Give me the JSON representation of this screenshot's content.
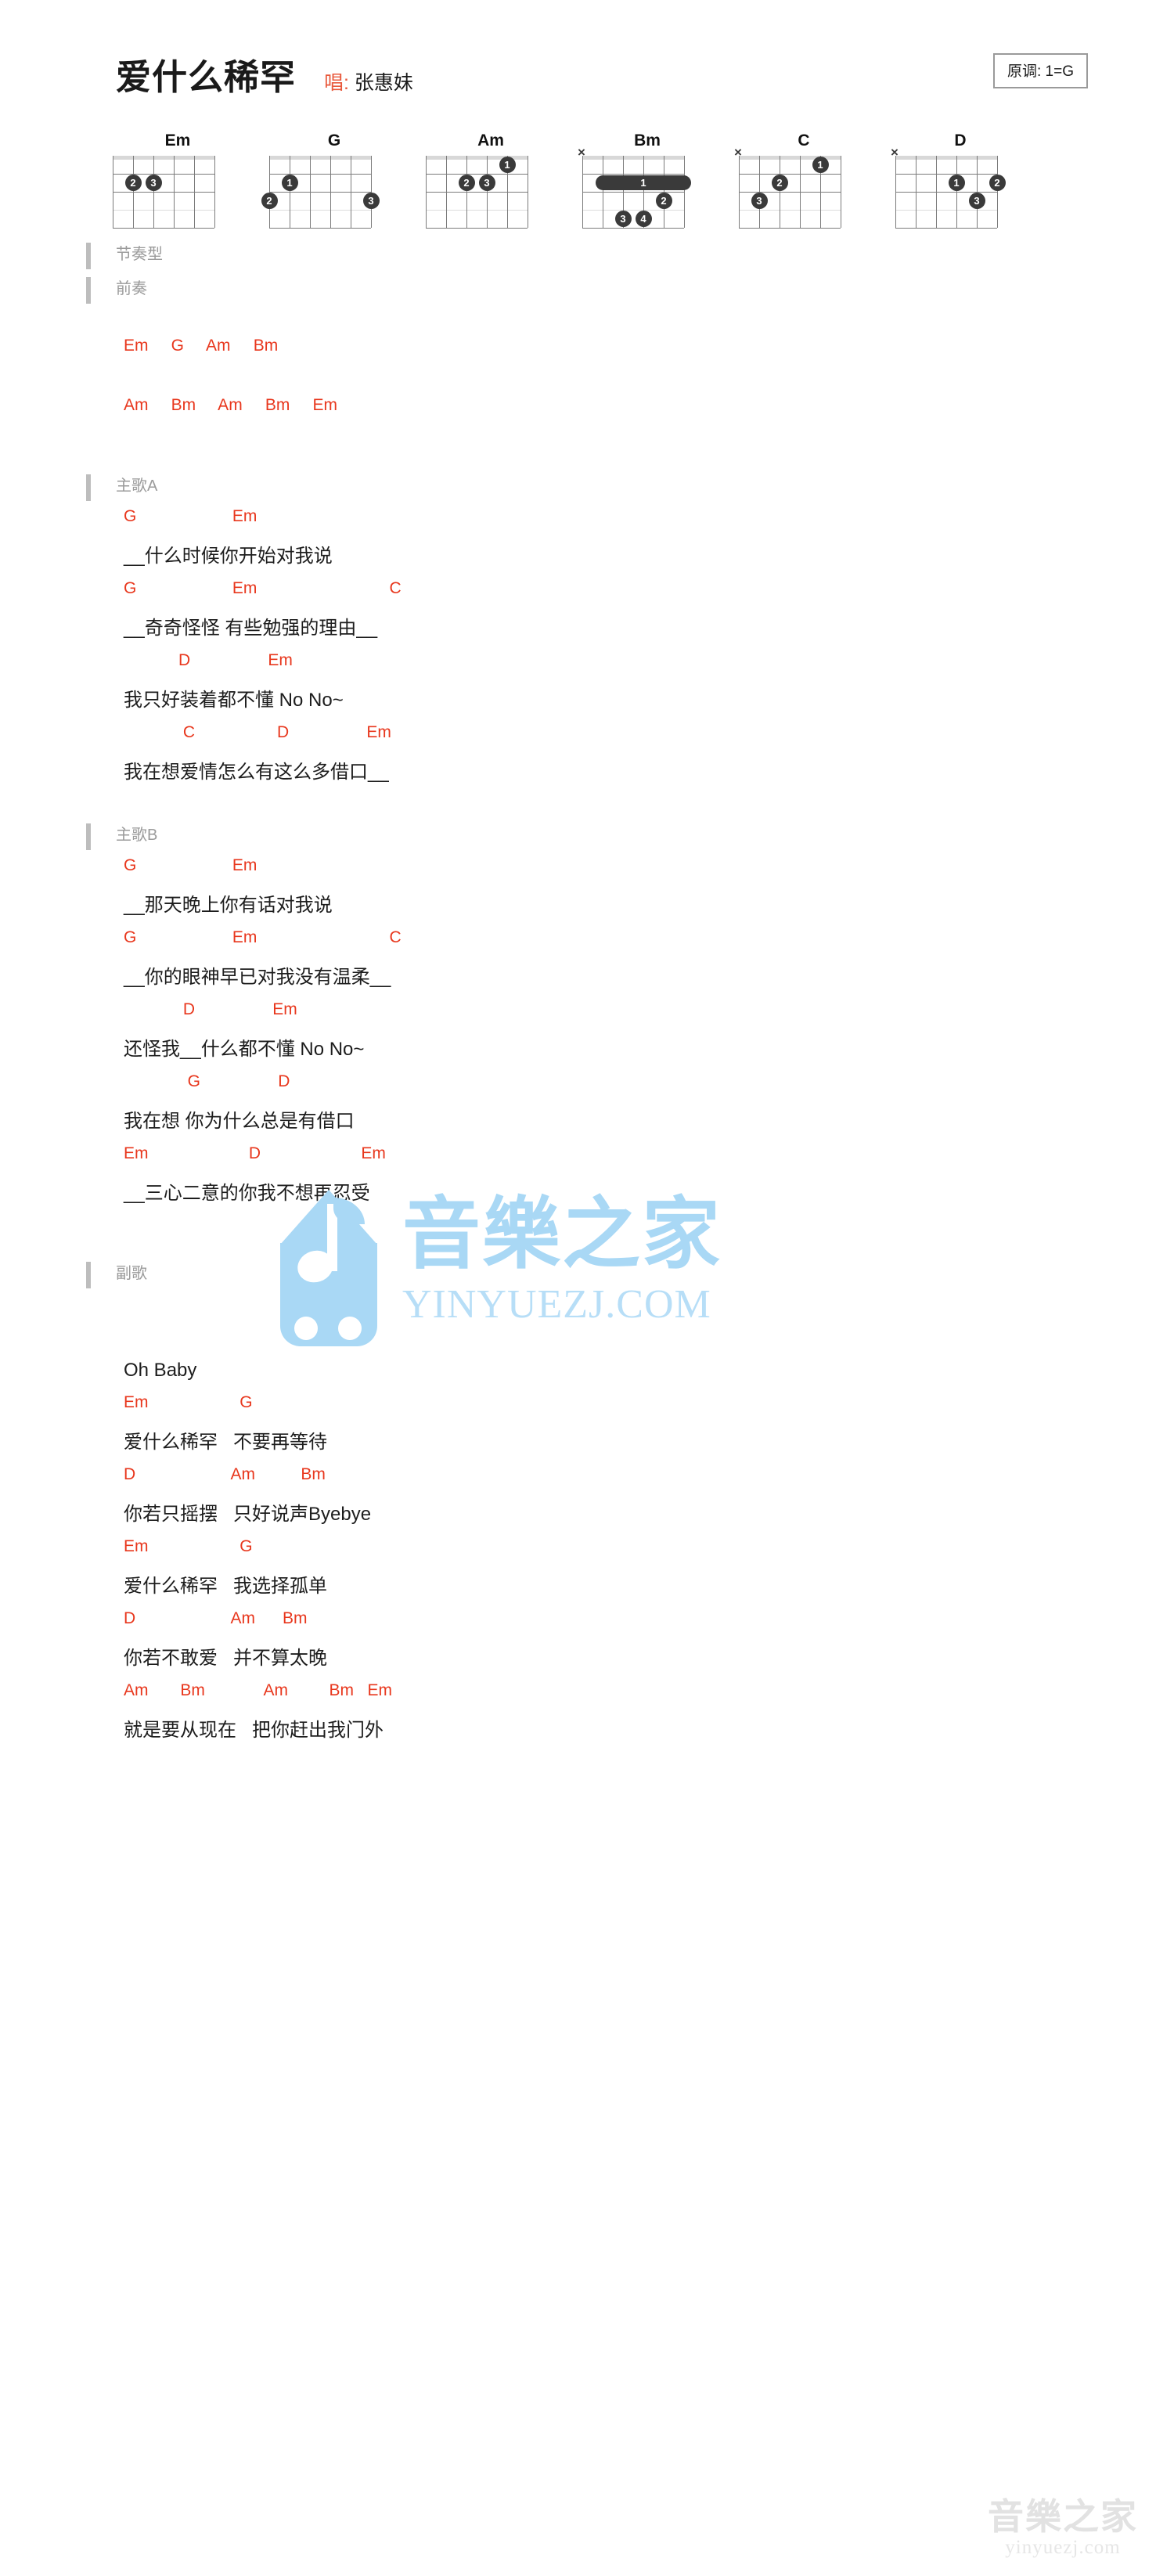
{
  "header": {
    "song_title": "爱什么稀罕",
    "singer_label": "唱:",
    "singer_name": "张惠妹",
    "key_text": "原调: 1=G"
  },
  "chords": [
    {
      "name": "Em",
      "mute": "",
      "dots": [
        {
          "string": 5,
          "fret": 2,
          "finger": "2"
        },
        {
          "string": 4,
          "fret": 2,
          "finger": "3"
        }
      ],
      "barre": null
    },
    {
      "name": "G",
      "mute": "",
      "dots": [
        {
          "string": 5,
          "fret": 2,
          "finger": "1"
        },
        {
          "string": 6,
          "fret": 3,
          "finger": "2"
        },
        {
          "string": 1,
          "fret": 3,
          "finger": "3"
        }
      ],
      "barre": null
    },
    {
      "name": "Am",
      "mute": "",
      "dots": [
        {
          "string": 2,
          "fret": 1,
          "finger": "1"
        },
        {
          "string": 4,
          "fret": 2,
          "finger": "2"
        },
        {
          "string": 3,
          "fret": 2,
          "finger": "3"
        }
      ],
      "barre": null
    },
    {
      "name": "Bm",
      "mute": "×",
      "dots": [
        {
          "string": 2,
          "fret": 3,
          "finger": "2"
        },
        {
          "string": 4,
          "fret": 4,
          "finger": "3"
        },
        {
          "string": 3,
          "fret": 4,
          "finger": "4"
        }
      ],
      "barre": {
        "fret": 2,
        "from_string": 5,
        "to_string": 1,
        "finger": "1"
      }
    },
    {
      "name": "C",
      "mute": "×",
      "dots": [
        {
          "string": 2,
          "fret": 1,
          "finger": "1"
        },
        {
          "string": 4,
          "fret": 2,
          "finger": "2"
        },
        {
          "string": 5,
          "fret": 3,
          "finger": "3"
        }
      ],
      "barre": null
    },
    {
      "name": "D",
      "mute": "×",
      "dots": [
        {
          "string": 3,
          "fret": 2,
          "finger": "1"
        },
        {
          "string": 1,
          "fret": 2,
          "finger": "2"
        },
        {
          "string": 2,
          "fret": 3,
          "finger": "3"
        }
      ],
      "barre": null
    }
  ],
  "sections": {
    "rhythm": "节奏型",
    "intro": "前奏",
    "verse_a": "主歌A",
    "verse_b": "主歌B",
    "chorus": "副歌"
  },
  "intro_lines": [
    "Em     G     Am     Bm",
    "Am     Bm     Am     Bm     Em"
  ],
  "verse_a": [
    {
      "chords": "G                     Em",
      "lyric": "__什么时候你开始对我说"
    },
    {
      "chords": "G                     Em                             C",
      "lyric": "__奇奇怪怪 有些勉强的理由__"
    },
    {
      "chords": "            D                 Em",
      "lyric": "我只好装着都不懂 No No~"
    },
    {
      "chords": "             C                  D                 Em",
      "lyric": "我在想爱情怎么有这么多借口__"
    }
  ],
  "verse_b": [
    {
      "chords": "G                     Em",
      "lyric": "__那天晚上你有话对我说"
    },
    {
      "chords": "G                     Em                             C",
      "lyric": "__你的眼神早已对我没有温柔__"
    },
    {
      "chords": "             D                 Em",
      "lyric": "还怪我__什么都不懂 No No~"
    },
    {
      "chords": "              G                 D",
      "lyric": "我在想 你为什么总是有借口"
    },
    {
      "chords": "Em                      D                      Em",
      "lyric": "__三心二意的你我不想再忍受"
    }
  ],
  "chorus": [
    {
      "chords": "",
      "lyric": "Oh Baby"
    },
    {
      "chords": "Em                    G",
      "lyric": "爱什么稀罕   不要再等待"
    },
    {
      "chords": "D                     Am          Bm",
      "lyric": "你若只摇摆   只好说声Byebye"
    },
    {
      "chords": "Em                    G",
      "lyric": "爱什么稀罕   我选择孤单"
    },
    {
      "chords": "D                     Am      Bm",
      "lyric": "你若不敢爱   并不算太晚"
    },
    {
      "chords": "Am       Bm             Am         Bm   Em",
      "lyric": "就是要从现在   把你赶出我门外"
    }
  ],
  "watermark": {
    "brand_cn": "音樂之家",
    "brand_en": "YINYUEZJ.COM",
    "corner_cn": "音樂之家",
    "corner_en": "yinyuezj.com"
  },
  "colors": {
    "chord_red": "#e8371d",
    "section_gray": "#9b9b9b",
    "watermark_blue": "#a9d8f5"
  }
}
